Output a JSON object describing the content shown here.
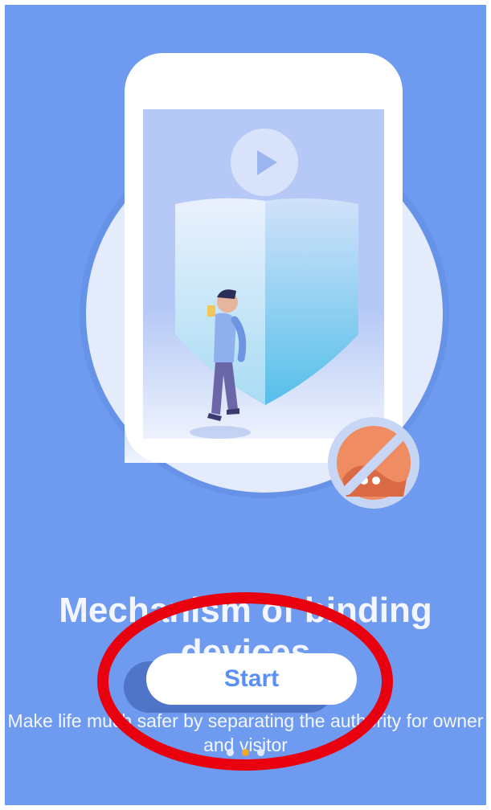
{
  "onboarding": {
    "title": "Mechanism of binding devices",
    "subtitle": "Make life much safer by separating the authority for owner and visitor",
    "start_label": "Start",
    "page_indicator": {
      "count": 3,
      "active_index": 1
    }
  },
  "icons": {
    "hero": "phone-shield-illustration",
    "play": "play-icon",
    "prohibited": "prohibited-icon"
  },
  "colors": {
    "background": "#6e9bf0",
    "button": "#ffffff",
    "button_text": "#5b8ff4",
    "annotation": "#e8000f",
    "active_dot": "#f5a623"
  }
}
